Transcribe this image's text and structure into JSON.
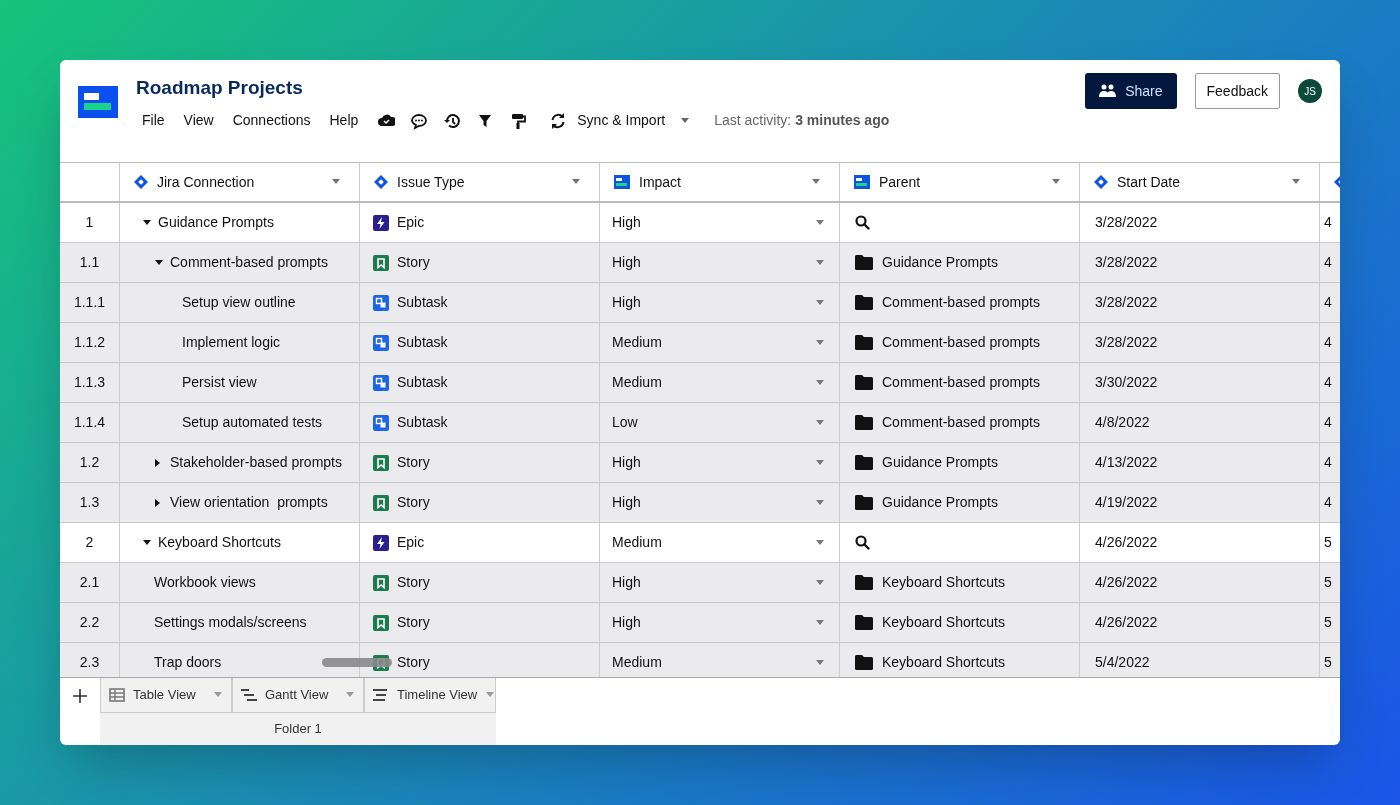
{
  "header": {
    "title": "Roadmap Projects",
    "menu": [
      "File",
      "View",
      "Connections",
      "Help"
    ],
    "sync": "Sync & Import",
    "activity_label": "Last activity:",
    "activity_value": "3 minutes ago",
    "share": "Share",
    "feedback": "Feedback",
    "avatar": "JS"
  },
  "table": {
    "columns": [
      {
        "label": "Jira Connection",
        "kind": "jira"
      },
      {
        "label": "Issue Type",
        "kind": "jira"
      },
      {
        "label": "Impact",
        "kind": "field"
      },
      {
        "label": "Parent",
        "kind": "field"
      },
      {
        "label": "Start Date",
        "kind": "jira"
      },
      {
        "kind": "jira"
      }
    ],
    "rows": [
      {
        "number": "1",
        "title": "Guidance Prompts",
        "expanded": true,
        "kind": "epic",
        "issue_type": "Epic",
        "impact": "High",
        "start": "3/28/2022",
        "column_6": "4",
        "children": [
          {
            "number": "1.1",
            "title": "Comment-based prompts",
            "expanded": true,
            "kind": "story",
            "issue_type": "Story",
            "impact": "High",
            "parent": "Guidance Prompts",
            "start": "3/28/2022",
            "column_6": "4",
            "children": [
              {
                "number": "1.1.1",
                "title": "Setup view outline",
                "kind": "subtask",
                "issue_type": "Subtask",
                "impact": "High",
                "parent": "Comment-based prompts",
                "start": "3/28/2022",
                "column_6": "4"
              },
              {
                "number": "1.1.2",
                "title": "Implement logic",
                "kind": "subtask",
                "issue_type": "Subtask",
                "impact": "Medium",
                "parent": "Comment-based prompts",
                "start": "3/28/2022",
                "column_6": "4"
              },
              {
                "number": "1.1.3",
                "title": "Persist view",
                "kind": "subtask",
                "issue_type": "Subtask",
                "impact": "Medium",
                "parent": "Comment-based prompts",
                "start": "3/30/2022",
                "column_6": "4"
              },
              {
                "number": "1.1.4",
                "title": "Setup automated tests",
                "kind": "subtask",
                "issue_type": "Subtask",
                "impact": "Low",
                "parent": "Comment-based prompts",
                "start": "4/8/2022",
                "column_6": "4"
              }
            ]
          },
          {
            "number": "1.2",
            "title": "Stakeholder-based prompts",
            "expanded": false,
            "kind": "story",
            "issue_type": "Story",
            "impact": "High",
            "parent": "Guidance Prompts",
            "start": "4/13/2022",
            "column_6": "4"
          },
          {
            "number": "1.3",
            "title": "View orientation  prompts",
            "expanded": false,
            "kind": "story",
            "issue_type": "Story",
            "impact": "High",
            "parent": "Guidance Prompts",
            "start": "4/19/2022",
            "column_6": "4"
          }
        ]
      },
      {
        "number": "2",
        "title": "Keyboard Shortcuts",
        "expanded": true,
        "kind": "epic",
        "issue_type": "Epic",
        "impact": "Medium",
        "start": "4/26/2022",
        "column_6": "5",
        "children": [
          {
            "number": "2.1",
            "title": "Workbook views",
            "kind": "story",
            "issue_type": "Story",
            "impact": "High",
            "parent": "Keyboard Shortcuts",
            "start": "4/26/2022",
            "column_6": "5"
          },
          {
            "number": "2.2",
            "title": "Settings modals/screens",
            "kind": "story",
            "issue_type": "Story",
            "impact": "High",
            "parent": "Keyboard Shortcuts",
            "start": "4/26/2022",
            "column_6": "5"
          },
          {
            "number": "2.3",
            "title": "Trap doors",
            "kind": "story",
            "issue_type": "Story",
            "impact": "Medium",
            "parent": "Keyboard Shortcuts",
            "start": "5/4/2022",
            "column_6": "5"
          }
        ]
      }
    ]
  },
  "view_tabs": [
    {
      "label": "Table View",
      "kind": "table"
    },
    {
      "label": "Gantt View",
      "kind": "gantt"
    },
    {
      "label": "Timeline View",
      "kind": "timeline"
    }
  ],
  "folder": "Folder 1"
}
